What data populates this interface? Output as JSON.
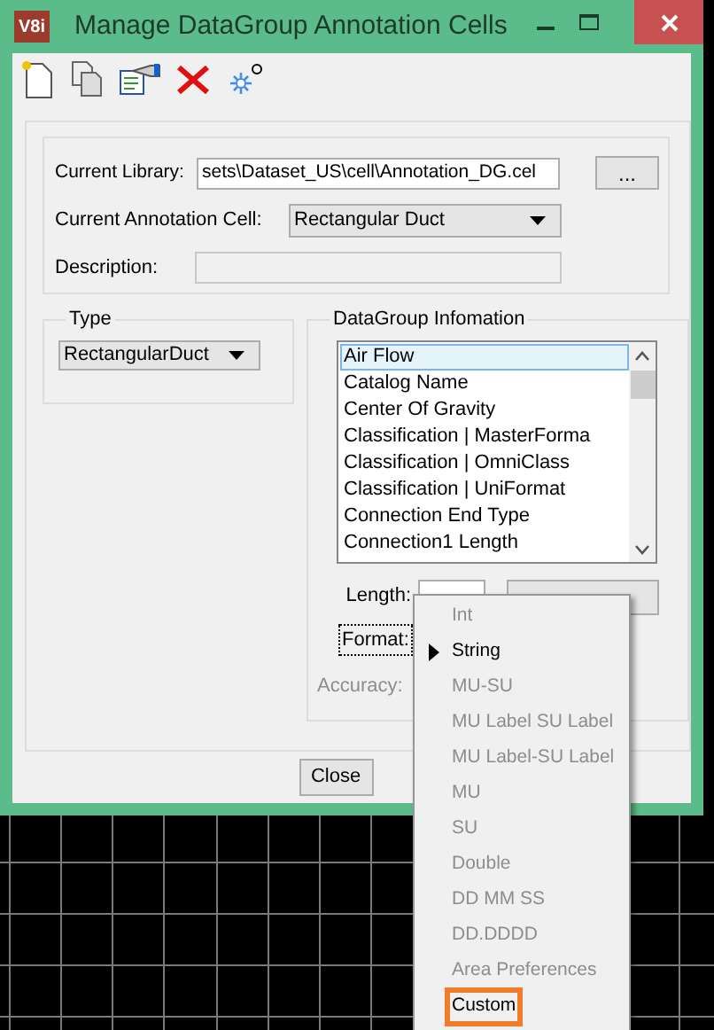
{
  "window": {
    "title": "Manage DataGroup Annotation Cells",
    "app_icon": "V8i"
  },
  "library": {
    "label": "Current Library:",
    "value": "sets\\Dataset_US\\cell\\Annotation_DG.cel",
    "browse": "..."
  },
  "annotation_cell": {
    "label": "Current Annotation Cell:",
    "value": "Rectangular Duct"
  },
  "description": {
    "label": "Description:"
  },
  "type_group": {
    "title": "Type",
    "value": "RectangularDuct"
  },
  "datagroup": {
    "title": "DataGroup Infomation",
    "items": [
      {
        "label": "Air Flow",
        "selected": true
      },
      {
        "label": "Catalog Name",
        "selected": false
      },
      {
        "label": "Center Of Gravity",
        "selected": false
      },
      {
        "label": "Classification | MasterForma",
        "selected": false
      },
      {
        "label": "Classification | OmniClass",
        "selected": false
      },
      {
        "label": "Classification | UniFormat",
        "selected": false
      },
      {
        "label": "Connection End Type",
        "selected": false
      },
      {
        "label": "Connection1 Length",
        "selected": false
      }
    ],
    "length_label": "Length:",
    "format_label": "Format:",
    "accuracy": {
      "label": "Accuracy:",
      "disabled": true
    }
  },
  "close_button": "Close",
  "format_menu": [
    {
      "label": "Int",
      "disabled": true,
      "checked": false,
      "selected": false
    },
    {
      "label": "String",
      "disabled": false,
      "checked": true,
      "selected": false
    },
    {
      "label": "MU-SU",
      "disabled": true,
      "checked": false,
      "selected": false
    },
    {
      "label": "MU Label SU Label",
      "disabled": true,
      "checked": false,
      "selected": false
    },
    {
      "label": "MU Label-SU Label",
      "disabled": true,
      "checked": false,
      "selected": false
    },
    {
      "label": "MU",
      "disabled": true,
      "checked": false,
      "selected": false
    },
    {
      "label": "SU",
      "disabled": true,
      "checked": false,
      "selected": false
    },
    {
      "label": "Double",
      "disabled": true,
      "checked": false,
      "selected": false
    },
    {
      "label": "DD MM SS",
      "disabled": true,
      "checked": false,
      "selected": false
    },
    {
      "label": "DD.DDDD",
      "disabled": true,
      "checked": false,
      "selected": false
    },
    {
      "label": "Area Preferences",
      "disabled": true,
      "checked": false,
      "selected": false
    },
    {
      "label": "Custom",
      "disabled": false,
      "checked": false,
      "selected": true
    }
  ]
}
